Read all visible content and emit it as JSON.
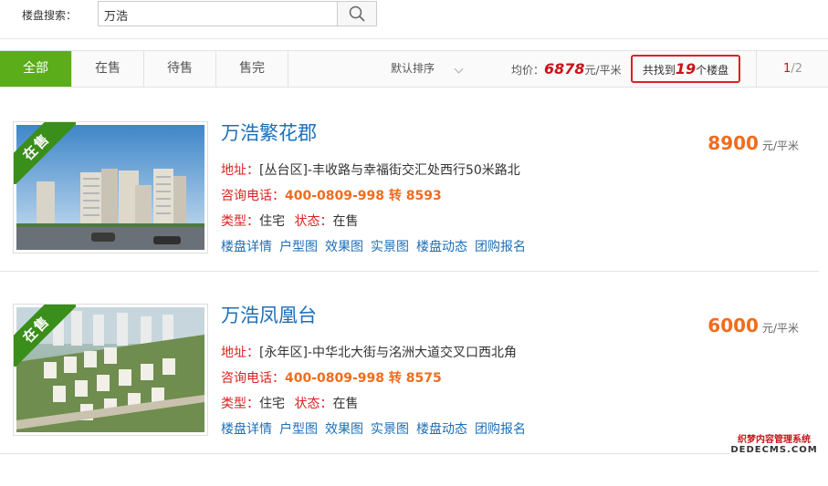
{
  "search": {
    "label": "楼盘搜索：",
    "value": "万浩"
  },
  "filters": {
    "tabs": [
      "全部",
      "在售",
      "待售",
      "售完"
    ],
    "active_tab": "全部",
    "sort_label": "默认排序",
    "avg_label": "均价：",
    "avg_price": "6878",
    "avg_unit": "元/平米",
    "found_prefix": "共找到",
    "found_count": "19",
    "found_suffix": "个楼盘",
    "page_current": "1",
    "page_total": "/2"
  },
  "listings": [
    {
      "title": "万浩繁花郡",
      "badge": "在售",
      "address_label": "地址：",
      "address": "[丛台区]-丰收路与幸福街交汇处西行50米路北",
      "phone_label": "咨询电话：",
      "phone": "400-0809-998 转 8593",
      "type_label": "类型：",
      "type": "住宅",
      "status_label": "状态：",
      "status": "在售",
      "price": "8900",
      "price_unit": "元/平米",
      "links": [
        "楼盘详情",
        "户型图",
        "效果图",
        "实景图",
        "楼盘动态",
        "团购报名"
      ]
    },
    {
      "title": "万浩凤凰台",
      "badge": "在售",
      "address_label": "地址：",
      "address": "[永年区]-中华北大街与洺洲大道交叉口西北角",
      "phone_label": "咨询电话：",
      "phone": "400-0809-998 转 8575",
      "type_label": "类型：",
      "type": "住宅",
      "status_label": "状态：",
      "status": "在售",
      "price": "6000",
      "price_unit": "元/平米",
      "links": [
        "楼盘详情",
        "户型图",
        "效果图",
        "实景图",
        "楼盘动态",
        "团购报名"
      ]
    }
  ],
  "watermark": {
    "line1": "织梦内容管理系统",
    "line2": "DEDECMS.COM"
  },
  "colors": {
    "accent_green": "#5bad19",
    "price_orange": "#f06c1d",
    "title_blue": "#1d6fb9",
    "label_red": "#d9231f"
  }
}
